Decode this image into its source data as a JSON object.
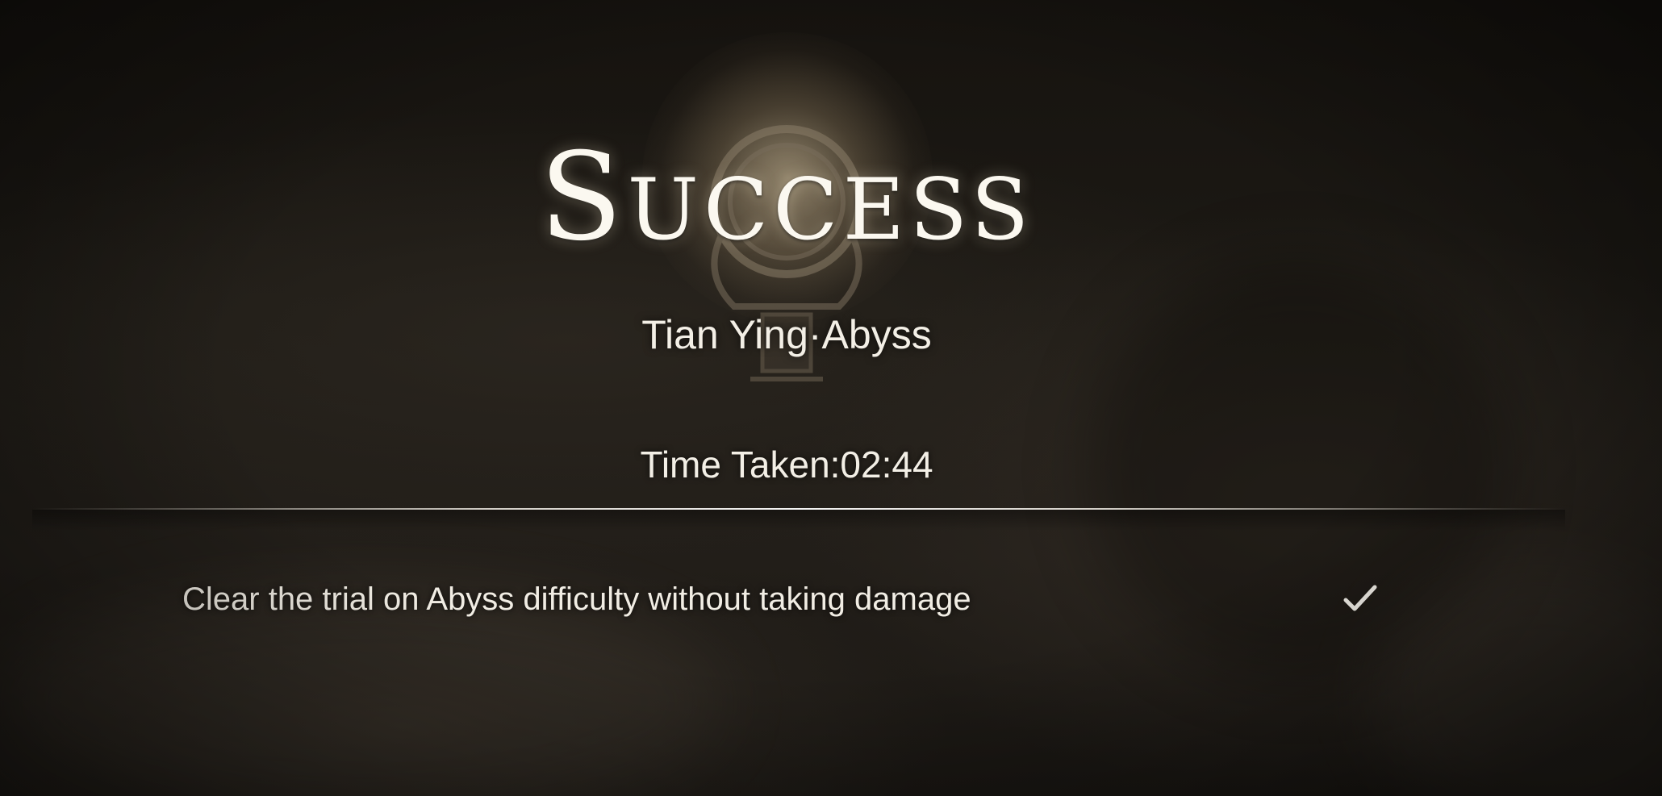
{
  "result": {
    "title": "Success",
    "trial_name": "Tian Ying·Abyss",
    "time_taken": "Time Taken:02:44"
  },
  "objectives": [
    {
      "text": "Clear the trial on Abyss difficulty without taking damage",
      "status_icon": "checkmark-icon",
      "completed": true
    }
  ],
  "colors": {
    "text": "#f3efe6",
    "glow": "#ecd8b0",
    "background": "#1d1a15"
  }
}
